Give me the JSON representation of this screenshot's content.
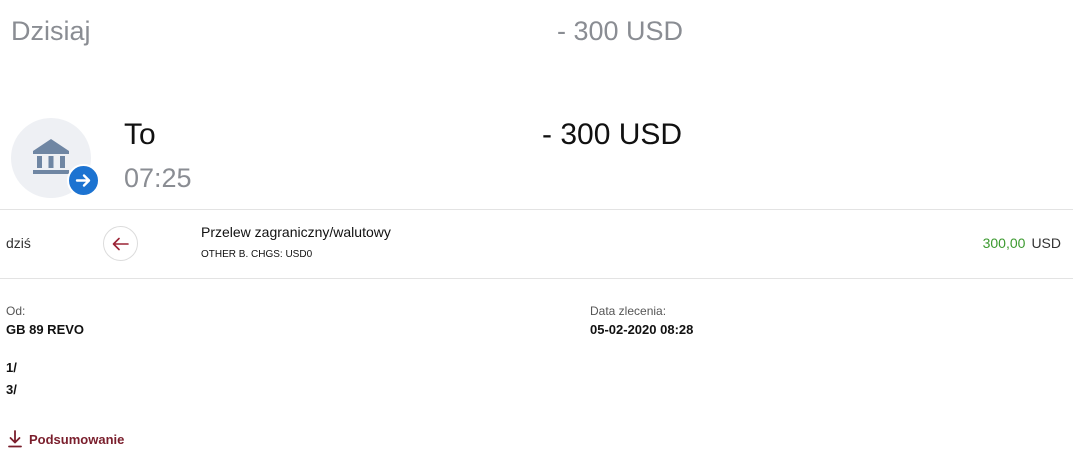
{
  "day_header": {
    "label": "Dzisiaj",
    "total": "- 300 USD"
  },
  "transaction": {
    "title": "To",
    "time": "07:25",
    "amount": "- 300 USD",
    "icon": "bank-icon",
    "badge_icon": "arrow-right-icon",
    "badge_color": "#1c73d1"
  },
  "detail_row": {
    "date": "dziś",
    "back_icon": "arrow-left-icon",
    "title": "Przelew zagraniczny/walutowy",
    "subtitle": "OTHER B. CHGS: USD0",
    "amount_value": "300,00",
    "amount_currency": "USD",
    "amount_color": "#3c9a2f"
  },
  "details": {
    "from_label": "Od:",
    "from_value": "GB 89 REVO",
    "order_date_label": "Data zlecenia:",
    "order_date_value": "05-02-2020 08:28",
    "line1": "1/",
    "line2": "3/"
  },
  "summary": {
    "label": "Podsumowanie",
    "icon": "download-icon",
    "color": "#7a1e2c"
  }
}
